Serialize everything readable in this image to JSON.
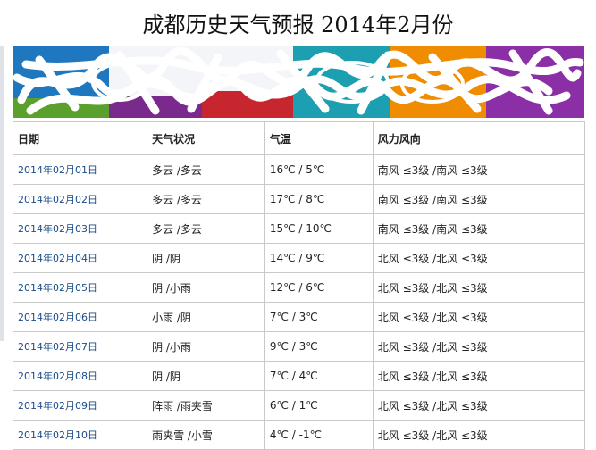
{
  "title": "成都历史天气预报 2014年2月份",
  "colors": {
    "date_link": "#1a4c8a",
    "banner_blocks": [
      "#1e77bf",
      "#5aa02c",
      "#7a2a8c",
      "#c8262e",
      "#1c9fb0",
      "#f08c00",
      "#8b2fa6"
    ]
  },
  "table": {
    "headers": [
      "日期",
      "天气状况",
      "气温",
      "风力风向"
    ],
    "rows": [
      [
        "2014年02月01日",
        "多云 /多云",
        "16℃ / 5℃",
        "南风 ≤3级 /南风 ≤3级"
      ],
      [
        "2014年02月02日",
        "多云 /多云",
        "17℃ / 8℃",
        "南风 ≤3级 /南风 ≤3级"
      ],
      [
        "2014年02月03日",
        "多云 /多云",
        "15℃ / 10℃",
        "南风 ≤3级 /南风 ≤3级"
      ],
      [
        "2014年02月04日",
        "阴 /阴",
        "14℃ / 9℃",
        "北风 ≤3级 /北风 ≤3级"
      ],
      [
        "2014年02月05日",
        "阴 /小雨",
        "12℃ / 6℃",
        "北风 ≤3级 /北风 ≤3级"
      ],
      [
        "2014年02月06日",
        "小雨 /阴",
        "7℃ / 3℃",
        "北风 ≤3级 /北风 ≤3级"
      ],
      [
        "2014年02月07日",
        "阴 /小雨",
        "9℃ / 3℃",
        "北风 ≤3级 /北风 ≤3级"
      ],
      [
        "2014年02月08日",
        "阴 /阴",
        "7℃ / 4℃",
        "北风 ≤3级 /北风 ≤3级"
      ],
      [
        "2014年02月09日",
        "阵雨 /雨夹雪",
        "6℃ / 1℃",
        "北风 ≤3级 /北风 ≤3级"
      ],
      [
        "2014年02月10日",
        "雨夹雪 /小雪",
        "4℃ / -1℃",
        "北风 ≤3级 /北风 ≤3级"
      ]
    ]
  }
}
